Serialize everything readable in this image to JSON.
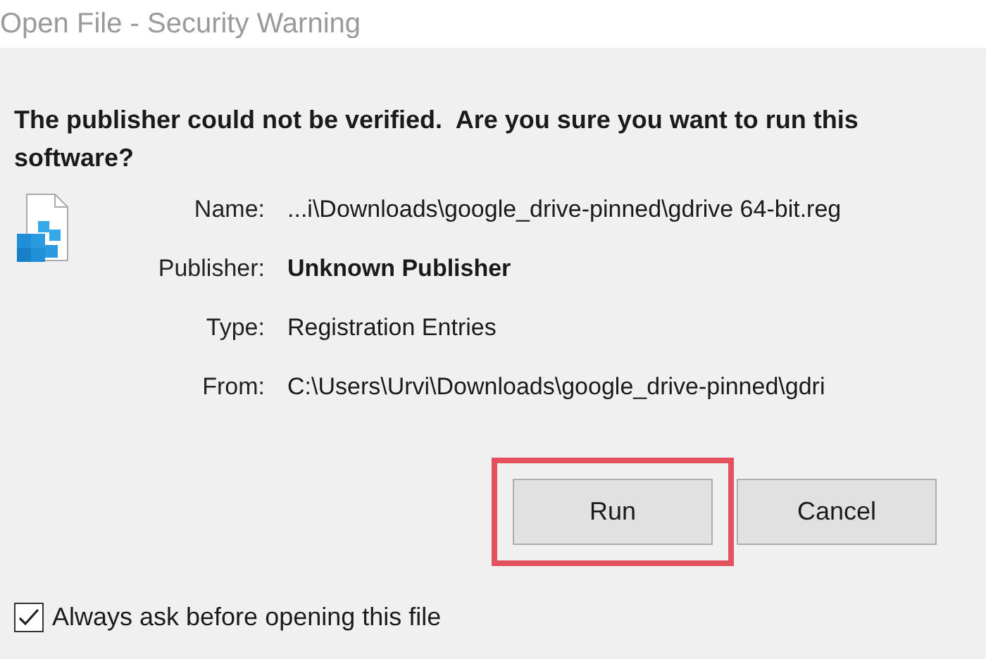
{
  "window": {
    "title": "Open File - Security Warning"
  },
  "heading": "The publisher could not be verified.  Are you sure you want to run this software?",
  "details": [
    {
      "label": "Name:",
      "value": "...i\\Downloads\\google_drive-pinned\\gdrive 64-bit.reg",
      "bold": false
    },
    {
      "label": "Publisher:",
      "value": "Unknown Publisher",
      "bold": true
    },
    {
      "label": "Type:",
      "value": "Registration Entries",
      "bold": false
    },
    {
      "label": "From:",
      "value": "C:\\Users\\Urvi\\Downloads\\google_drive-pinned\\gdri",
      "bold": false
    }
  ],
  "buttons": [
    {
      "label": "Run",
      "highlighted": true
    },
    {
      "label": "Cancel",
      "highlighted": false
    }
  ],
  "checkbox": {
    "label": "Always ask before opening this file",
    "checked": true
  }
}
